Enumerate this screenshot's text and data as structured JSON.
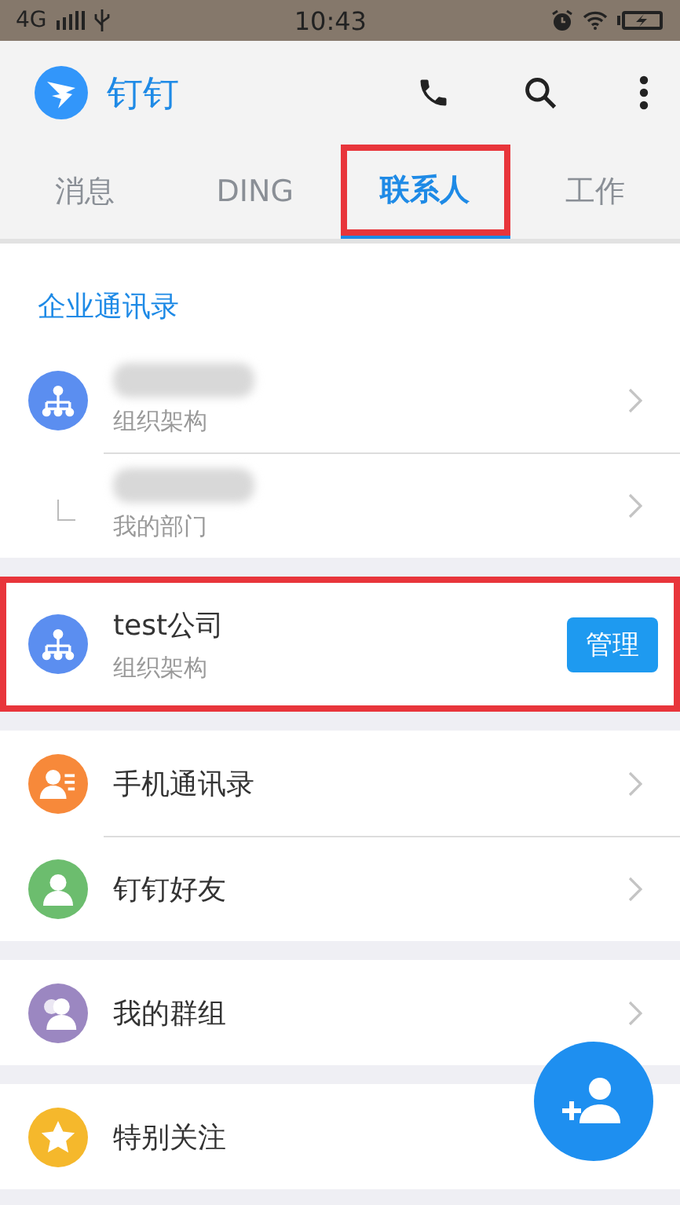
{
  "status_bar": {
    "network": "4G",
    "time": "10:43"
  },
  "app_bar": {
    "title": "钉钉"
  },
  "tabs": [
    {
      "label": "消息",
      "selected": false,
      "annotated": false
    },
    {
      "label": "DING",
      "selected": false,
      "annotated": false
    },
    {
      "label": "联系人",
      "selected": true,
      "annotated": true
    },
    {
      "label": "工作",
      "selected": false,
      "annotated": false
    }
  ],
  "sections": [
    {
      "header": "企业通讯录",
      "rows": [
        {
          "kind": "org",
          "color": "#5b8ef0",
          "redacted": true,
          "subtitle": "组织架构",
          "chevron": true,
          "annotated": false
        },
        {
          "kind": "branch",
          "redacted": true,
          "subtitle": "我的部门",
          "chevron": true,
          "annotated": false
        }
      ]
    },
    {
      "rows": [
        {
          "kind": "org",
          "color": "#5b8ef0",
          "title": "test公司",
          "subtitle": "组织架构",
          "action": "管理",
          "chevron": false,
          "annotated": true
        }
      ]
    },
    {
      "rows": [
        {
          "kind": "contacts",
          "color": "#f7893a",
          "title": "手机通讯录",
          "chevron": true,
          "annotated": false
        },
        {
          "kind": "person",
          "color": "#6cbd6e",
          "title": "钉钉好友",
          "chevron": true,
          "annotated": false
        }
      ]
    },
    {
      "rows": [
        {
          "kind": "group",
          "color": "#9b87c1",
          "title": "我的群组",
          "chevron": true,
          "annotated": false
        }
      ]
    },
    {
      "rows": [
        {
          "kind": "star",
          "color": "#f5b82c",
          "title": "特别关注",
          "chevron": false,
          "annotated": false
        }
      ]
    }
  ]
}
